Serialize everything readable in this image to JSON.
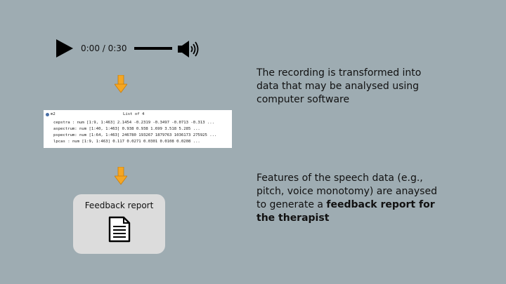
{
  "player": {
    "time": "0:00 / 0:30",
    "play_icon": "play-icon",
    "volume_icon": "volume-icon"
  },
  "arrows": {
    "color": "#f5a623",
    "icon": "down-arrow-icon"
  },
  "data_panel": {
    "variable": "m2",
    "type": "List of 4",
    "rows": [
      "cepstra : num [1:9, 1:463] 2.1454 -0.2319 -0.3497 -0.0713 -0.313 ...",
      "aspectrum: num [1:40, 1:463] 0.938 0.938 1.699 3.518 5.285 ...",
      "pspectrum: num [1:64, 1:463] 246780 193267 1879763 1036173 275925 ...",
      "lpcas : num [1:9, 1:463] 0.117 0.0271 0.0301 0.0108 0.0208 ..."
    ]
  },
  "report_card": {
    "title": "Feedback report",
    "icon": "document-icon"
  },
  "desc1": {
    "text": "The recording is transformed into data that may be analysed using computer software"
  },
  "desc2": {
    "text": "Features of the speech data (e.g., pitch, voice monotomy) are anaysed to generate a ",
    "bold": "feedback report for the therapist"
  }
}
